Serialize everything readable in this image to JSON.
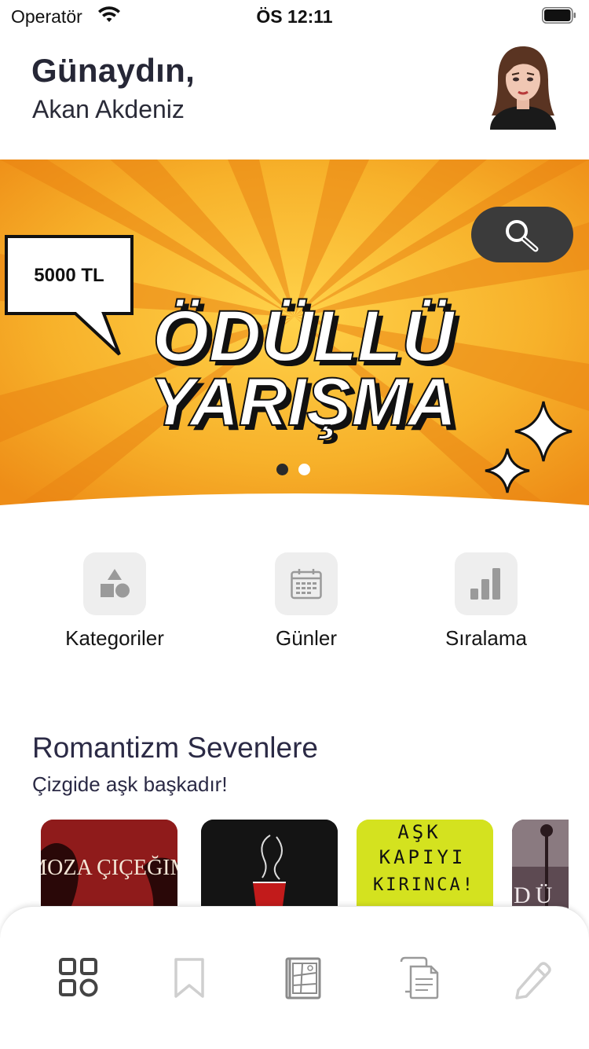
{
  "status_bar": {
    "carrier": "Operatör",
    "time": "ÖS 12:11"
  },
  "header": {
    "greeting": "Günaydın,",
    "user_name": "Akan Akdeniz"
  },
  "banner": {
    "badge_text": "5000 TL",
    "line1": "ÖDÜLLÜ",
    "line2": "YARIŞMA",
    "page_count": 2,
    "active_page": 1
  },
  "quick_actions": [
    {
      "label": "Kategoriler",
      "icon": "shapes-icon"
    },
    {
      "label": "Günler",
      "icon": "calendar-icon"
    },
    {
      "label": "Sıralama",
      "icon": "bar-chart-icon"
    }
  ],
  "section": {
    "title": "Romantizm Sevenlere",
    "subtitle": "Çizgide aşk başkadır!",
    "books": [
      {
        "cover_text": "MIMOZA ÇIÇEĞIMIN",
        "cover_color": "#8a1a1a"
      },
      {
        "cover_text": "",
        "cover_color": "#1a1a1a"
      },
      {
        "cover_text_lines": [
          "AŞK",
          "KAPIYI",
          "KIRINCA!"
        ],
        "cover_color": "#d4e21f"
      },
      {
        "cover_text": "DÜ",
        "cover_color": "#6b4a55"
      }
    ]
  },
  "tab_bar": {
    "tabs": [
      {
        "icon": "grid-icon",
        "active": true
      },
      {
        "icon": "bookmark-icon",
        "active": false
      },
      {
        "icon": "comic-book-icon",
        "active": false
      },
      {
        "icon": "documents-icon",
        "active": false
      },
      {
        "icon": "pencil-icon",
        "active": false
      }
    ]
  },
  "colors": {
    "banner_orange": "#f5a51a",
    "banner_dark": "#e98a12",
    "text_dark": "#262736",
    "tile_bg": "#eeeeee",
    "icon_gray": "#9a9a9a"
  }
}
